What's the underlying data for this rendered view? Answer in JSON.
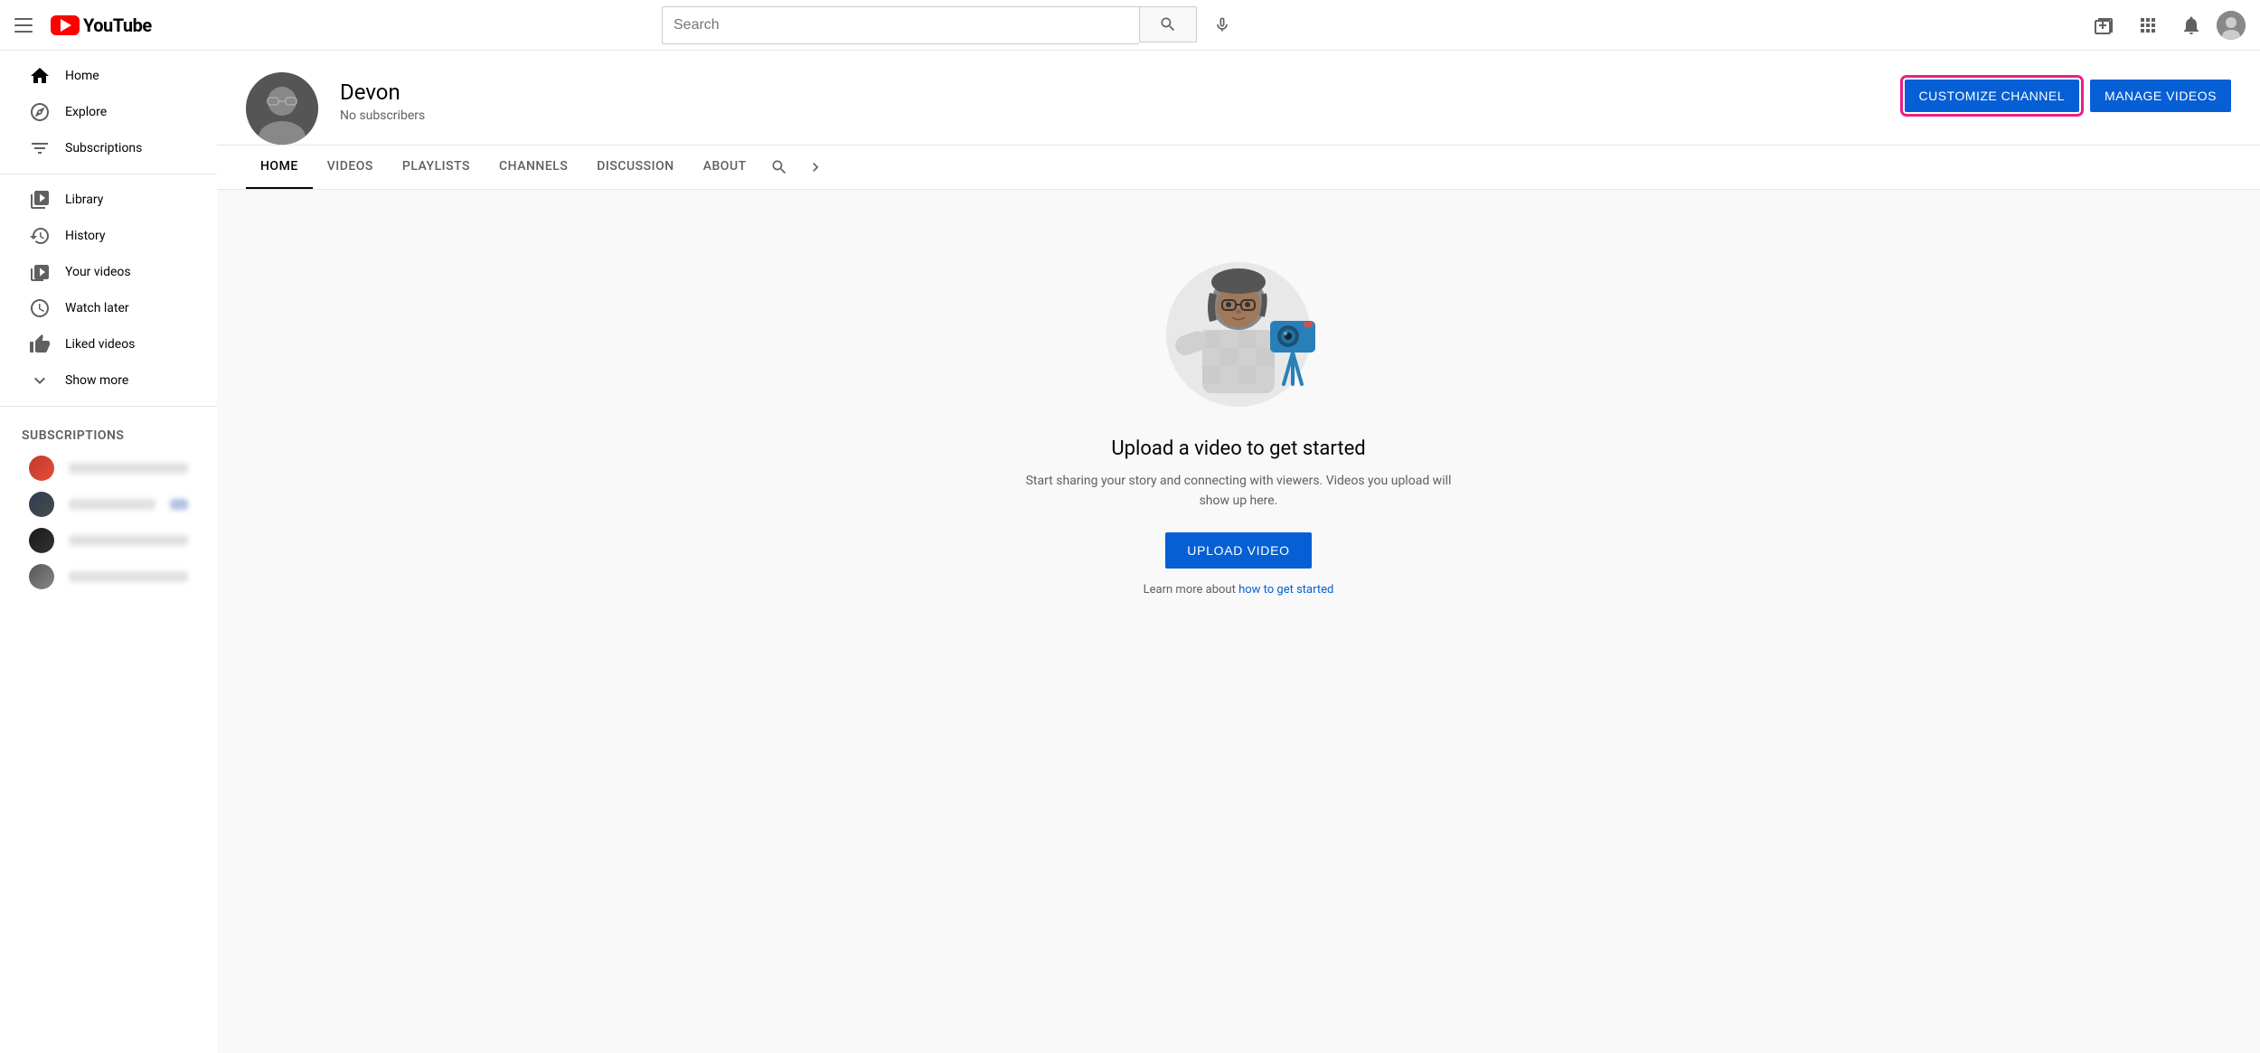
{
  "topnav": {
    "logo_text": "YouTube",
    "search_placeholder": "Search",
    "create_tooltip": "Create",
    "apps_tooltip": "YouTube apps",
    "notifications_tooltip": "Notifications",
    "account_tooltip": "Account"
  },
  "sidebar": {
    "items": [
      {
        "id": "home",
        "label": "Home"
      },
      {
        "id": "explore",
        "label": "Explore"
      },
      {
        "id": "subscriptions",
        "label": "Subscriptions"
      }
    ],
    "items2": [
      {
        "id": "library",
        "label": "Library"
      },
      {
        "id": "history",
        "label": "History"
      },
      {
        "id": "your-videos",
        "label": "Your videos"
      },
      {
        "id": "watch-later",
        "label": "Watch later"
      },
      {
        "id": "liked-videos",
        "label": "Liked videos"
      },
      {
        "id": "show-more",
        "label": "Show more"
      }
    ],
    "subscriptions_label": "SUBSCRIPTIONS"
  },
  "channel": {
    "name": "Devon",
    "subscribers": "No subscribers",
    "customize_btn": "CUSTOMIZE CHANNEL",
    "manage_btn": "MANAGE VIDEOS"
  },
  "tabs": [
    {
      "id": "home",
      "label": "HOME",
      "active": true
    },
    {
      "id": "videos",
      "label": "VIDEOS",
      "active": false
    },
    {
      "id": "playlists",
      "label": "PLAYLISTS",
      "active": false
    },
    {
      "id": "channels",
      "label": "CHANNELS",
      "active": false
    },
    {
      "id": "discussion",
      "label": "DISCUSSION",
      "active": false
    },
    {
      "id": "about",
      "label": "ABOUT",
      "active": false
    }
  ],
  "empty_state": {
    "title": "Upload a video to get started",
    "subtitle": "Start sharing your story and connecting with viewers. Videos you upload will show up here.",
    "upload_btn": "UPLOAD VIDEO",
    "learn_text": "Learn more about ",
    "learn_link_text": "how to get started"
  }
}
